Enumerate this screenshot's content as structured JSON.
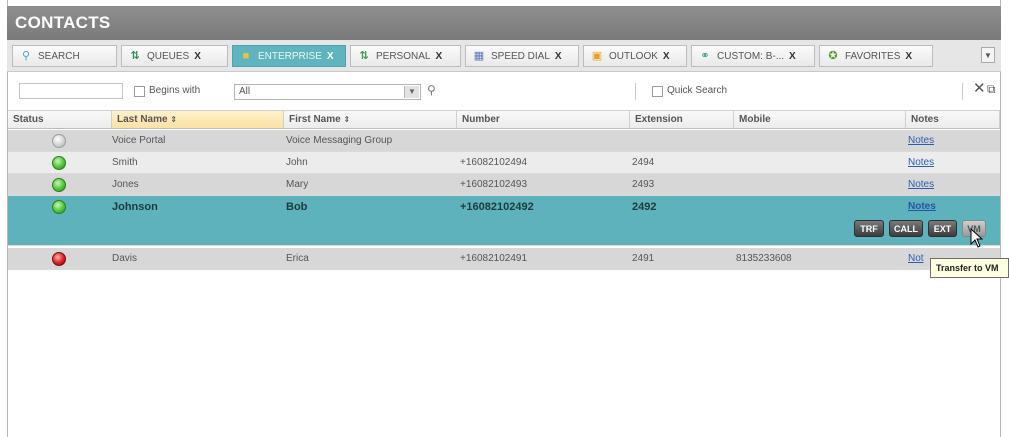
{
  "window": {
    "title": "CONTACTS"
  },
  "tabs": [
    {
      "label": "SEARCH",
      "icon": "search-icon",
      "closable": false,
      "active": false
    },
    {
      "label": "QUEUES",
      "icon": "queue-icon",
      "closable": true,
      "active": false
    },
    {
      "label": "ENTERPRISE",
      "icon": "enterprise-icon",
      "closable": true,
      "active": true
    },
    {
      "label": "PERSONAL",
      "icon": "personal-icon",
      "closable": true,
      "active": false
    },
    {
      "label": "SPEED DIAL",
      "icon": "speed-dial-icon",
      "closable": true,
      "active": false
    },
    {
      "label": "OUTLOOK",
      "icon": "outlook-icon",
      "closable": true,
      "active": false
    },
    {
      "label": "CUSTOM: B-...",
      "icon": "custom-icon",
      "closable": true,
      "active": false
    },
    {
      "label": "FAVORITES",
      "icon": "favorites-icon",
      "closable": true,
      "active": false
    }
  ],
  "tab_close_glyph": "X",
  "search": {
    "value": "",
    "begins_with_label": "Begins with",
    "filter_selected": "All",
    "quick_search_label": "Quick Search"
  },
  "table": {
    "columns": [
      "Status",
      "Last Name",
      "First Name",
      "Number",
      "Extension",
      "Mobile",
      "Notes"
    ],
    "sorted_column": "Last Name",
    "rows": [
      {
        "status": "grey",
        "last": "Voice Portal",
        "first": "Voice Messaging Group",
        "number": "",
        "ext": "",
        "mobile": "",
        "notes": "Notes"
      },
      {
        "status": "green",
        "last": "Smith",
        "first": "John",
        "number": "+16082102494",
        "ext": "2494",
        "mobile": "",
        "notes": "Notes"
      },
      {
        "status": "green",
        "last": "Jones",
        "first": "Mary",
        "number": "+16082102493",
        "ext": "2493",
        "mobile": "",
        "notes": "Notes"
      },
      {
        "status": "green",
        "last": "Johnson",
        "first": "Bob",
        "number": "+16082102492",
        "ext": "2492",
        "mobile": "",
        "notes": "Notes"
      },
      {
        "status": "red",
        "last": "Davis",
        "first": "Erica",
        "number": "+16082102491",
        "ext": "2491",
        "mobile": "8135233608",
        "notes": "Not"
      }
    ],
    "row_actions": [
      "TRF",
      "CALL",
      "EXT",
      "VM"
    ]
  },
  "tooltip": "Transfer to VM",
  "colors": {
    "selected_row": "#5db2bb",
    "active_tab": "#5fb4bd",
    "title_bar": "#858585"
  }
}
